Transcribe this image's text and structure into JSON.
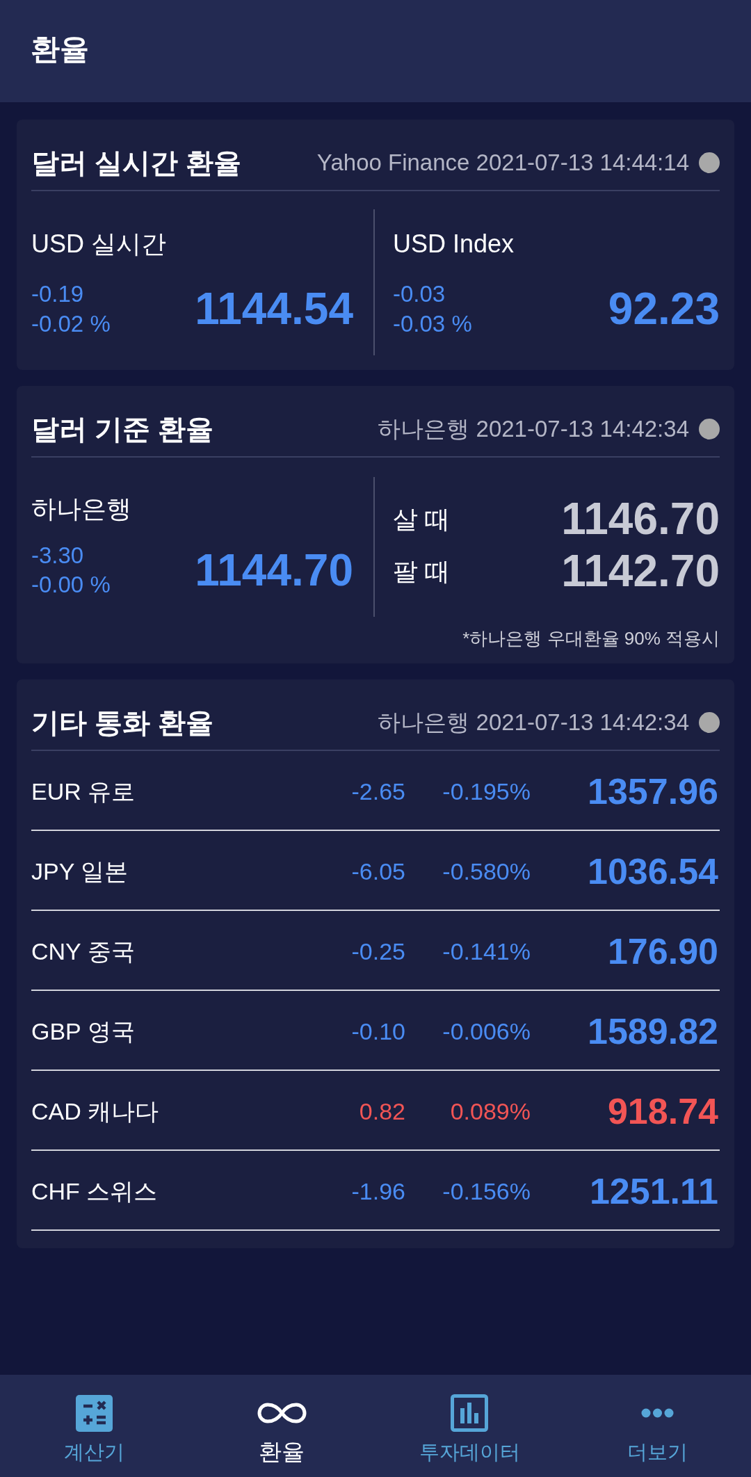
{
  "app_bar": {
    "title": "환율"
  },
  "sections": [
    {
      "kind": "pair",
      "title": "달러 실시간 환율",
      "source": "Yahoo Finance 2021-07-13 14:44:14",
      "panels": [
        {
          "label": "USD 실시간",
          "change": "-0.19",
          "change_pct": "-0.02 %",
          "value": "1144.54",
          "rising": false
        },
        {
          "label": "USD Index",
          "change": "-0.03",
          "change_pct": "-0.03 %",
          "value": "92.23",
          "rising": false
        }
      ]
    },
    {
      "kind": "bank",
      "title": "달러 기준 환율",
      "source": "하나은행 2021-07-13 14:42:34",
      "panel": {
        "label": "하나은행",
        "change": "-3.30",
        "change_pct": "-0.00 %",
        "value": "1144.70",
        "rising": false
      },
      "quotes": [
        {
          "label": "살 때",
          "value": "1146.70"
        },
        {
          "label": "팔 때",
          "value": "1142.70"
        }
      ],
      "footnote": "*하나은행 우대환율 90% 적용시"
    },
    {
      "kind": "list",
      "title": "기타 통화 환율",
      "source": "하나은행 2021-07-13 14:42:34",
      "rows": [
        {
          "name": "EUR 유로",
          "change": "-2.65",
          "change_pct": "-0.195%",
          "value": "1357.96",
          "rising": false
        },
        {
          "name": "JPY 일본",
          "change": "-6.05",
          "change_pct": "-0.580%",
          "value": "1036.54",
          "rising": false
        },
        {
          "name": "CNY 중국",
          "change": "-0.25",
          "change_pct": "-0.141%",
          "value": "176.90",
          "rising": false
        },
        {
          "name": "GBP 영국",
          "change": "-0.10",
          "change_pct": "-0.006%",
          "value": "1589.82",
          "rising": false
        },
        {
          "name": "CAD 캐나다",
          "change": "0.82",
          "change_pct": "0.089%",
          "value": "918.74",
          "rising": true
        },
        {
          "name": "CHF 스위스",
          "change": "-1.96",
          "change_pct": "-0.156%",
          "value": "1251.11",
          "rising": false
        }
      ]
    }
  ],
  "bottom_nav": [
    {
      "label": "계산기",
      "selected": false
    },
    {
      "label": "환율",
      "selected": true
    },
    {
      "label": "투자데이터",
      "selected": false
    },
    {
      "label": "더보기",
      "selected": false
    }
  ]
}
